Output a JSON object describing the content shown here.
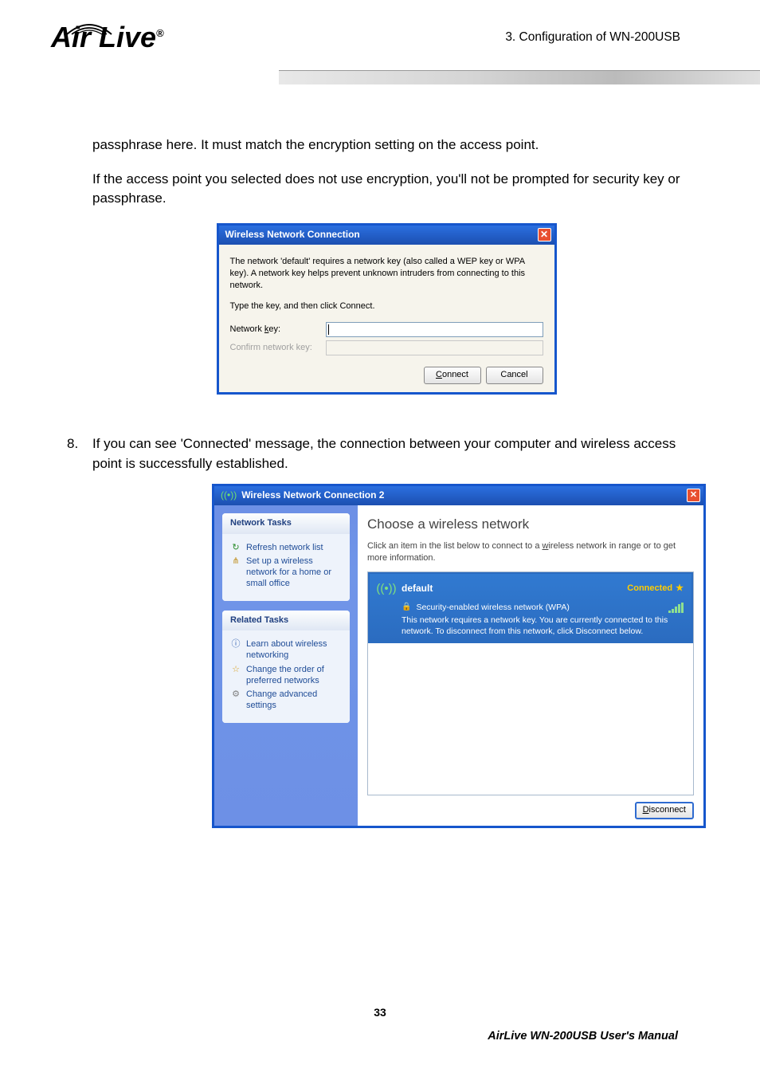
{
  "header": {
    "breadcrumb": "3.   Configuration  of  WN-200USB",
    "logo": "Air Live",
    "logo_reg": "®"
  },
  "body": {
    "p1": "passphrase here. It must match the encryption setting on the access point.",
    "p2": "If the access point you selected does not use encryption, you'll not be prompted for security key or passphrase.",
    "step8_num": "8.",
    "step8_text": "If you can see 'Connected' message, the connection between your computer and wireless access point is successfully established."
  },
  "dialog1": {
    "title": "Wireless Network Connection",
    "desc": "The network 'default' requires a network key (also called a WEP key or WPA key). A network key helps prevent unknown intruders from connecting to this network.",
    "hint": "Type the key, and then click Connect.",
    "label_key_pre": "Network ",
    "label_key_ul": "k",
    "label_key_post": "ey:",
    "label_confirm": "Confirm network key:",
    "value_key": "",
    "value_confirm": "",
    "btn_connect_ul": "C",
    "btn_connect_rest": "onnect",
    "btn_cancel": "Cancel"
  },
  "dialog2": {
    "title": "Wireless Network Connection 2",
    "tasks_hdr": "Network Tasks",
    "task_refresh": "Refresh network list",
    "task_setup": "Set up a wireless network for a home or small office",
    "related_hdr": "Related Tasks",
    "task_learn": "Learn about wireless networking",
    "task_order": "Change the order of preferred networks",
    "task_adv": "Change advanced settings",
    "main_heading": "Choose a wireless network",
    "main_sub_pre": "Click an item in the list below to connect to a ",
    "main_sub_ul": "w",
    "main_sub_post": "ireless network in range or to get more information.",
    "ssid": "default",
    "status": "Connected",
    "sec_line": "Security-enabled wireless network (WPA)",
    "conn_desc": "This network requires a network key. You are currently connected to this network. To disconnect from this network, click Disconnect below.",
    "btn_disconnect_ul": "D",
    "btn_disconnect_rest": "isconnect"
  },
  "footer": {
    "page_number": "33",
    "manual": "AirLive  WN-200USB  User's  Manual"
  }
}
